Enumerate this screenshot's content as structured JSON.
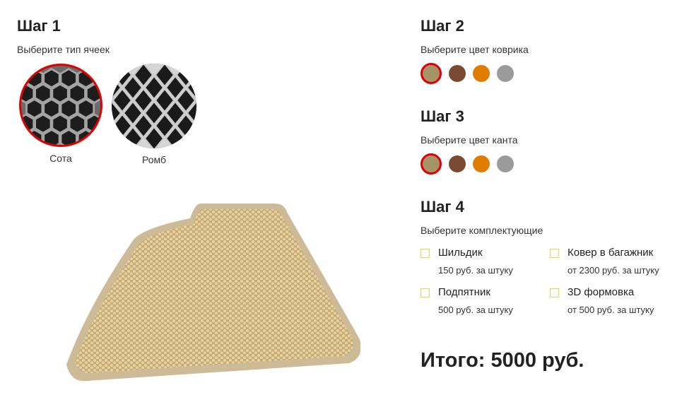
{
  "step1": {
    "title": "Шаг 1",
    "subtitle": "Выберите тип ячеек",
    "options": [
      {
        "label": "Сота",
        "selected": true,
        "pattern": "honeycomb-pattern"
      },
      {
        "label": "Ромб",
        "selected": false,
        "pattern": "rhombus-pattern"
      }
    ]
  },
  "step2": {
    "title": "Шаг 2",
    "subtitle": "Выберите цвет коврика",
    "colors": [
      {
        "hex": "#a89268",
        "selected": true
      },
      {
        "hex": "#7a4a33",
        "selected": false
      },
      {
        "hex": "#e07d00",
        "selected": false
      },
      {
        "hex": "#9b9b9b",
        "selected": false
      }
    ]
  },
  "step3": {
    "title": "Шаг 3",
    "subtitle": "Выберите цвет канта",
    "colors": [
      {
        "hex": "#a89268",
        "selected": true
      },
      {
        "hex": "#7a4a33",
        "selected": false
      },
      {
        "hex": "#e07d00",
        "selected": false
      },
      {
        "hex": "#9b9b9b",
        "selected": false
      }
    ]
  },
  "step4": {
    "title": "Шаг 4",
    "subtitle": "Выберите комплектующие",
    "items": [
      {
        "name": "Шильдик",
        "price": "150 руб. за штуку",
        "checked": false
      },
      {
        "name": "Ковер в багажник",
        "price": "от 2300 руб. за штуку",
        "checked": false
      },
      {
        "name": "Подпятник",
        "price": "500 руб. за штуку",
        "checked": false
      },
      {
        "name": "3D формовка",
        "price": "от 500 руб. за штуку",
        "checked": false
      }
    ]
  },
  "total": {
    "label": "Итого:",
    "value": "5000 руб."
  },
  "colors": {
    "accent_selected": "#e00000",
    "checkbox_border": "#e3d84a",
    "mat_color": "#d8c08f",
    "mat_edge": "#cdb795"
  }
}
